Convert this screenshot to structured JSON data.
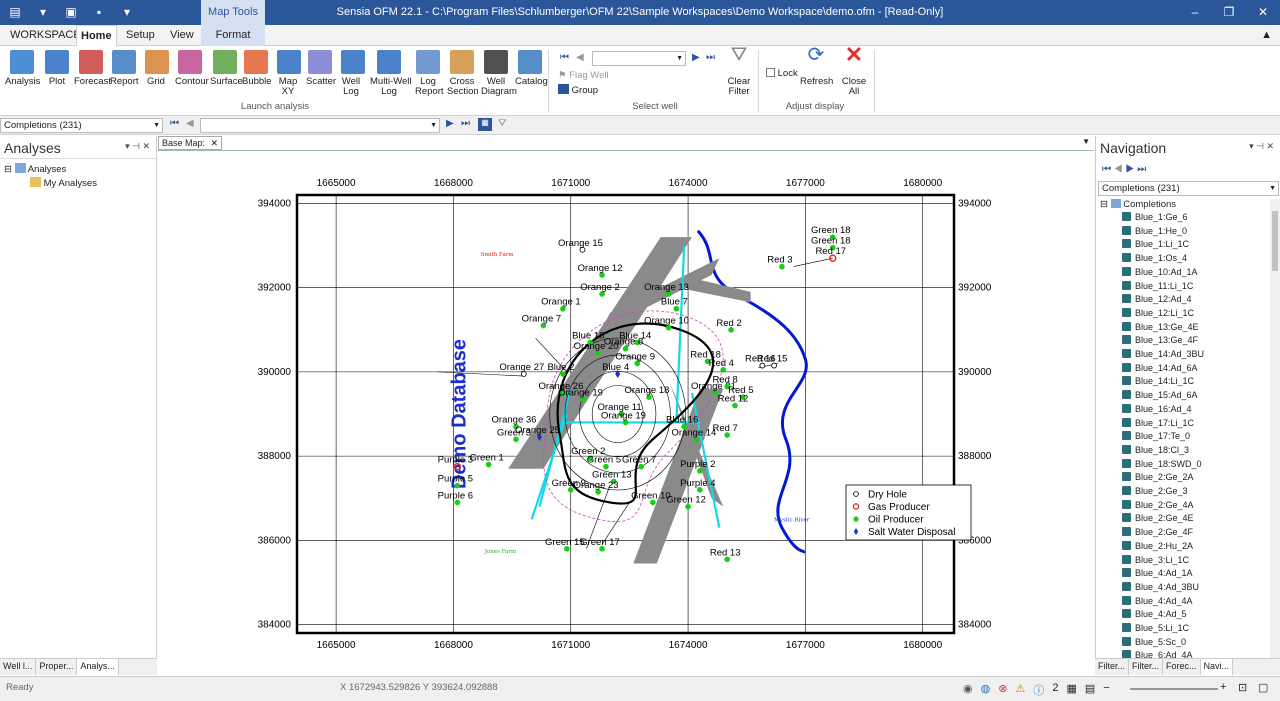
{
  "app": {
    "title": "Sensia OFM 22.1 - C:\\Program Files\\Schlumberger\\OFM 22\\Sample Workspaces\\Demo Workspace\\demo.ofm - [Read-Only]",
    "context_tab": "Map Tools"
  },
  "tabs": [
    "WORKSPACE",
    "Home",
    "Setup",
    "View",
    "Format"
  ],
  "ribbon": {
    "buttons": [
      {
        "label": "Analysis",
        "icon": "analysis-icon"
      },
      {
        "label": "Plot",
        "icon": "plot-icon"
      },
      {
        "label": "Forecast",
        "icon": "forecast-icon"
      },
      {
        "label": "Report",
        "icon": "report-icon"
      },
      {
        "label": "Grid",
        "icon": "grid-icon"
      },
      {
        "label": "Contour",
        "icon": "contour-icon"
      },
      {
        "label": "Surface",
        "icon": "surface-icon"
      },
      {
        "label": "Bubble",
        "icon": "bubble-icon"
      },
      {
        "label": "Map\nXY",
        "icon": "map-xy-icon"
      },
      {
        "label": "Scatter",
        "icon": "scatter-icon"
      },
      {
        "label": "Well\nLog",
        "icon": "well-log-icon"
      },
      {
        "label": "Multi-Well\nLog",
        "icon": "multi-well-log-icon"
      },
      {
        "label": "Log\nReport",
        "icon": "log-report-icon"
      },
      {
        "label": "Cross\nSection",
        "icon": "cross-section-icon"
      },
      {
        "label": "Well\nDiagram",
        "icon": "well-diagram-icon"
      },
      {
        "label": "Catalog",
        "icon": "catalog-icon"
      }
    ],
    "group_launch": "Launch analysis",
    "flag_well": "Flag Well",
    "group_btn": "Group",
    "group_select": "Select well",
    "clear_filter": "Clear\nFilter",
    "lock": "Lock",
    "refresh": "Refresh",
    "close_all": "Close\nAll",
    "group_adjust": "Adjust display"
  },
  "toolbar2": {
    "completions": "Completions (231)",
    "well_value": ""
  },
  "left_panel": {
    "title": "Analyses",
    "tree": [
      {
        "label": "Analyses",
        "level": 0
      },
      {
        "label": "My Analyses",
        "level": 1
      }
    ],
    "bottom_tabs": [
      "Well l...",
      "Proper...",
      "Analys..."
    ]
  },
  "doc_tab": "Base Map:",
  "map": {
    "watermark": "Demo Database",
    "x_ticks": [
      "1665000",
      "1668000",
      "1671000",
      "1674000",
      "1677000",
      "1680000"
    ],
    "y_ticks": [
      "394000",
      "392000",
      "390000",
      "388000",
      "386000",
      "384000"
    ],
    "legend": [
      "Dry Hole",
      "Gas Producer",
      "Oil Producer",
      "Salt Water Disposal"
    ],
    "small_labels": [
      "Smith Farm",
      "Mystic River",
      "Jones Farm"
    ],
    "wells": [
      {
        "label": "Green 18",
        "x": 1677700,
        "y": 393200,
        "type": "oil"
      },
      {
        "label": "Green 18",
        "x": 1677700,
        "y": 392950,
        "type": "oil"
      },
      {
        "label": "Red 17",
        "x": 1677700,
        "y": 392700,
        "type": "gas"
      },
      {
        "label": "Red 3",
        "x": 1676400,
        "y": 392500,
        "type": "oil"
      },
      {
        "label": "Orange 15",
        "x": 1671300,
        "y": 392900,
        "type": "dry"
      },
      {
        "label": "Orange 12",
        "x": 1671800,
        "y": 392300,
        "type": "oil"
      },
      {
        "label": "Orange 2",
        "x": 1671800,
        "y": 391850,
        "type": "oil"
      },
      {
        "label": "Orange 1",
        "x": 1670800,
        "y": 391500,
        "type": "oil"
      },
      {
        "label": "Orange 7",
        "x": 1670300,
        "y": 391100,
        "type": "oil"
      },
      {
        "label": "Orange 13",
        "x": 1673500,
        "y": 391850,
        "type": "oil"
      },
      {
        "label": "Blue 7",
        "x": 1673700,
        "y": 391500,
        "type": "oil"
      },
      {
        "label": "Orange 10",
        "x": 1673500,
        "y": 391050,
        "type": "oil"
      },
      {
        "label": "Red 2",
        "x": 1675100,
        "y": 391000,
        "type": "oil"
      },
      {
        "label": "Blue 18",
        "x": 1671500,
        "y": 390700,
        "type": "oil"
      },
      {
        "label": "Blue 14",
        "x": 1672700,
        "y": 390700,
        "type": "oil"
      },
      {
        "label": "Orange 8",
        "x": 1672400,
        "y": 390550,
        "type": "oil"
      },
      {
        "label": "Orange 20",
        "x": 1671700,
        "y": 390450,
        "type": "oil"
      },
      {
        "label": "Orange 27",
        "x": 1669800,
        "y": 389950,
        "type": "dry"
      },
      {
        "label": "Blue 2",
        "x": 1670800,
        "y": 389950,
        "type": "oil"
      },
      {
        "label": "Blue 4",
        "x": 1672200,
        "y": 389950,
        "type": "swd"
      },
      {
        "label": "Orange 9",
        "x": 1672700,
        "y": 390200,
        "type": "oil"
      },
      {
        "label": "Red 18",
        "x": 1674500,
        "y": 390250,
        "type": "oil"
      },
      {
        "label": "Red 4",
        "x": 1674900,
        "y": 390050,
        "type": "oil"
      },
      {
        "label": "Red 16",
        "x": 1675900,
        "y": 390150,
        "type": "dry"
      },
      {
        "label": "Red 15",
        "x": 1676200,
        "y": 390150,
        "type": "dry"
      },
      {
        "label": "Orange 26",
        "x": 1670800,
        "y": 389500,
        "type": "oil"
      },
      {
        "label": "Orange 19",
        "x": 1671300,
        "y": 389350,
        "type": "oil"
      },
      {
        "label": "Orange 18",
        "x": 1673000,
        "y": 389400,
        "type": "oil"
      },
      {
        "label": "Orange 21",
        "x": 1674700,
        "y": 389500,
        "type": "oil"
      },
      {
        "label": "Red 8",
        "x": 1675000,
        "y": 389650,
        "type": "oil"
      },
      {
        "label": "Red 5",
        "x": 1675400,
        "y": 389400,
        "type": "oil"
      },
      {
        "label": "Red 12",
        "x": 1675200,
        "y": 389200,
        "type": "oil"
      },
      {
        "label": "Orange 11",
        "x": 1672300,
        "y": 389000,
        "type": "oil"
      },
      {
        "label": "Orange 19",
        "x": 1672400,
        "y": 388800,
        "type": "oil"
      },
      {
        "label": "Orange 36",
        "x": 1669600,
        "y": 388700,
        "type": "oil"
      },
      {
        "label": "Orange 25",
        "x": 1670200,
        "y": 388450,
        "type": "swd"
      },
      {
        "label": "Green 3",
        "x": 1669600,
        "y": 388400,
        "type": "oil"
      },
      {
        "label": "Blue 16",
        "x": 1673900,
        "y": 388700,
        "type": "oil"
      },
      {
        "label": "Red 7",
        "x": 1675000,
        "y": 388500,
        "type": "oil"
      },
      {
        "label": "Orange 14",
        "x": 1674200,
        "y": 388400,
        "type": "oil"
      },
      {
        "label": "Green 2",
        "x": 1671500,
        "y": 387950,
        "type": "oil"
      },
      {
        "label": "Green 1",
        "x": 1668900,
        "y": 387800,
        "type": "oil"
      },
      {
        "label": "Purple 3",
        "x": 1668100,
        "y": 387750,
        "type": "gas"
      },
      {
        "label": "Green 5",
        "x": 1671900,
        "y": 387750,
        "type": "oil"
      },
      {
        "label": "Green 7",
        "x": 1672800,
        "y": 387750,
        "type": "oil"
      },
      {
        "label": "Purple 2",
        "x": 1674300,
        "y": 387650,
        "type": "oil"
      },
      {
        "label": "Purple 5",
        "x": 1668100,
        "y": 387300,
        "type": "oil"
      },
      {
        "label": "Green 13",
        "x": 1672100,
        "y": 387400,
        "type": "oil"
      },
      {
        "label": "Green 9",
        "x": 1671000,
        "y": 387200,
        "type": "oil"
      },
      {
        "label": "Orange 23",
        "x": 1671700,
        "y": 387150,
        "type": "oil"
      },
      {
        "label": "Purple 4",
        "x": 1674300,
        "y": 387200,
        "type": "oil"
      },
      {
        "label": "Purple 6",
        "x": 1668100,
        "y": 386900,
        "type": "oil"
      },
      {
        "label": "Green 10",
        "x": 1673100,
        "y": 386900,
        "type": "oil"
      },
      {
        "label": "Green 12",
        "x": 1674000,
        "y": 386800,
        "type": "oil"
      },
      {
        "label": "Green 15",
        "x": 1670900,
        "y": 385800,
        "type": "oil"
      },
      {
        "label": "Green 17",
        "x": 1671800,
        "y": 385800,
        "type": "oil"
      },
      {
        "label": "Red 13",
        "x": 1675000,
        "y": 385550,
        "type": "oil"
      }
    ]
  },
  "right_panel": {
    "title": "Navigation",
    "combo": "Completions (231)",
    "root": "Completions",
    "items": [
      "Blue_1:Ge_6",
      "Blue_1:He_0",
      "Blue_1:Li_1C",
      "Blue_1:Os_4",
      "Blue_10:Ad_1A",
      "Blue_11:Li_1C",
      "Blue_12:Ad_4",
      "Blue_12:Li_1C",
      "Blue_13:Ge_4E",
      "Blue_13:Ge_4F",
      "Blue_14:Ad_3BU",
      "Blue_14:Ad_6A",
      "Blue_14:Li_1C",
      "Blue_15:Ad_6A",
      "Blue_16:Ad_4",
      "Blue_17:Li_1C",
      "Blue_17:Te_0",
      "Blue_18:Cl_3",
      "Blue_18:SWD_0",
      "Blue_2:Ge_2A",
      "Blue_2:Ge_3",
      "Blue_2:Ge_4A",
      "Blue_2:Ge_4E",
      "Blue_2:Ge_4F",
      "Blue_2:Hu_2A",
      "Blue_3:Li_1C",
      "Blue_4:Ad_1A",
      "Blue_4:Ad_3BU",
      "Blue_4:Ad_4A",
      "Blue_4:Ad_5",
      "Blue_5:Li_1C",
      "Blue_5:Sc_0",
      "Blue_6:Ad_4A"
    ],
    "bottom_tabs": [
      "Filter...",
      "Filter...",
      "Forec...",
      "Navi..."
    ]
  },
  "status": {
    "ready": "Ready",
    "coords": "X 1672943.529826 Y 393624.092888",
    "count": "2"
  }
}
